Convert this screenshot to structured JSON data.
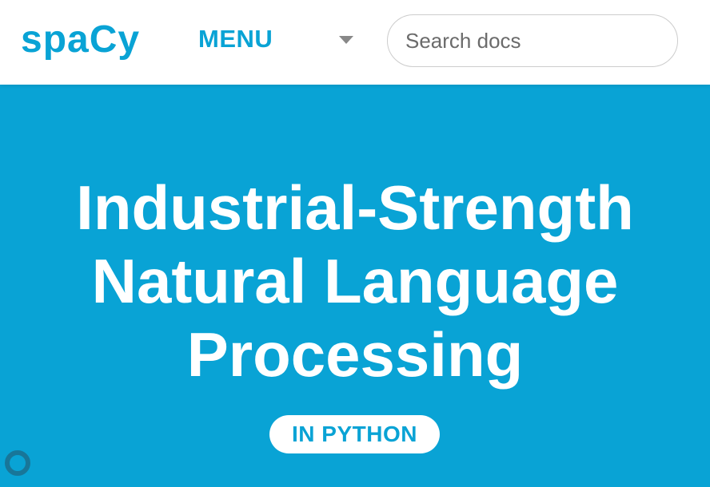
{
  "header": {
    "logo": "spaCy",
    "menu_label": "MENU",
    "menu_icon": "chevron-down-icon",
    "search": {
      "placeholder": "Search docs",
      "value": ""
    }
  },
  "hero": {
    "title_lines": [
      "Industrial-Strength",
      "Natural Language",
      "Processing"
    ],
    "badge": "IN PYTHON",
    "corner_icon": "ring-icon"
  },
  "colors": {
    "brand": "#09a3d5",
    "white": "#ffffff",
    "chevron": "#888888"
  }
}
